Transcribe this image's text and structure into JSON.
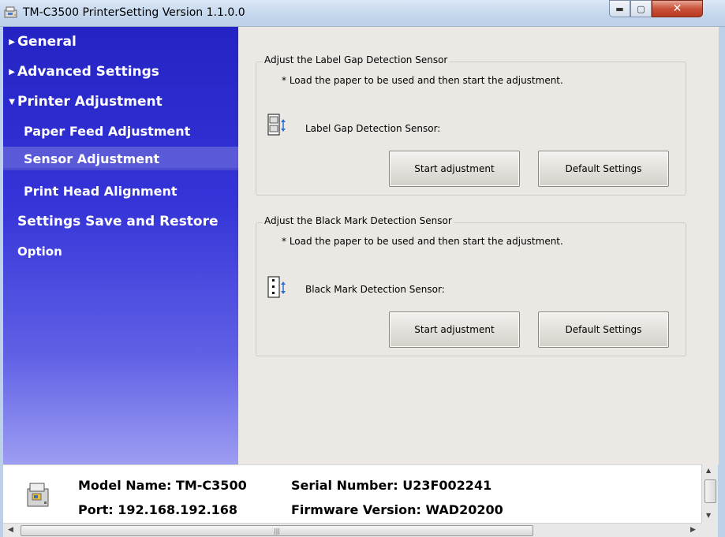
{
  "window": {
    "title": "TM-C3500 PrinterSetting Version 1.1.0.0",
    "minimize_glyph": "▬",
    "maximize_glyph": "▢",
    "close_glyph": "✕"
  },
  "sidebar": {
    "items": [
      {
        "label": "General",
        "arrow": "▶"
      },
      {
        "label": "Advanced Settings",
        "arrow": "▶"
      },
      {
        "label": "Printer Adjustment",
        "arrow": "▼"
      },
      {
        "label": "Paper Feed Adjustment"
      },
      {
        "label": "Sensor Adjustment",
        "selected": true
      },
      {
        "label": "Print Head Alignment"
      },
      {
        "label": "Settings Save and Restore"
      },
      {
        "label": "Option"
      }
    ]
  },
  "label_gap": {
    "title": "Adjust the Label Gap Detection Sensor",
    "note": "* Load the paper to be used and then start the adjustment.",
    "sensor_label": "Label Gap Detection Sensor:",
    "start_button": "Start adjustment",
    "default_button": "Default Settings"
  },
  "black_mark": {
    "title": "Adjust the Black Mark Detection Sensor",
    "note": "* Load the paper to be used and then start the adjustment.",
    "sensor_label": "Black Mark Detection Sensor:",
    "start_button": "Start adjustment",
    "default_button": "Default Settings"
  },
  "info": {
    "model": "Model Name: TM-C3500",
    "port": "Port: 192.168.192.168",
    "serial": "Serial Number: U23F002241",
    "firmware": "Firmware Version: WAD20200"
  },
  "scrollbars": {
    "grip": "|||",
    "up": "▲",
    "down": "▼",
    "left": "◀",
    "right": "▶"
  },
  "colors": {
    "sidebar_top": "#2424c4",
    "sidebar_bottom": "#9d9df2",
    "selected": "#5a5ad8",
    "content_bg": "#ece9e5"
  }
}
